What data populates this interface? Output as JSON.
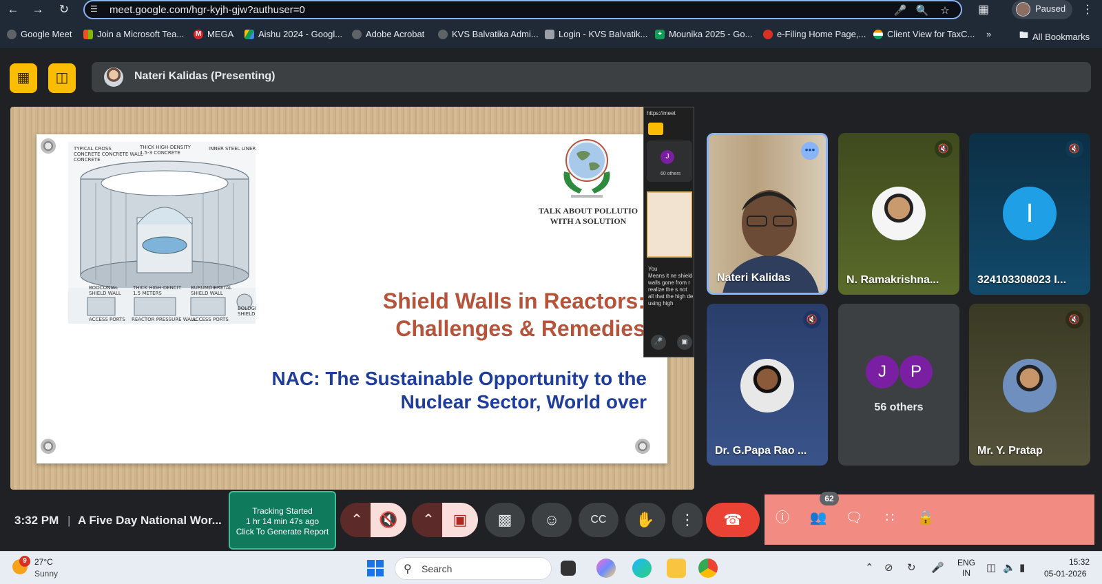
{
  "browser": {
    "url": "meet.google.com/hgr-kyjh-gjw?authuser=0",
    "profile_label": "Paused",
    "bookmarks": [
      {
        "label": "Google Meet",
        "color": "#e8eaed"
      },
      {
        "label": "Join a Microsoft Tea...",
        "color": "#f25022"
      },
      {
        "label": "MEGA",
        "color": "#d9272e"
      },
      {
        "label": "Aishu 2024 - Googl...",
        "color": "#0f9d58"
      },
      {
        "label": "Adobe Acrobat",
        "color": "#e8eaed"
      },
      {
        "label": "KVS Balvatika Admi...",
        "color": "#e8eaed"
      },
      {
        "label": "Login - KVS Balvatik...",
        "color": "#9aa0a6"
      },
      {
        "label": "Mounika 2025 - Go...",
        "color": "#0f9d58"
      },
      {
        "label": "e-Filing Home Page,...",
        "color": "#d93025"
      },
      {
        "label": "Client View for TaxC...",
        "color": "#f29900"
      }
    ],
    "more_bookmarks": "»",
    "all_bookmarks": "All Bookmarks"
  },
  "meet": {
    "presenter_label": "Nateri Kalidas (Presenting)",
    "slide": {
      "diagram_labels": {
        "typical": "TYPICAL CROSS\nCONCRETE CONCRETE WALL\nCONCRETE",
        "thick": "THICK HIGH-DENSITY\n1.5-3 CONCRETE",
        "inner": "INNER STEEL LINER",
        "bottom1": "BOOCONIAL\nSHIELD WALL",
        "bottom2": "THICK HIGH-DENCIT\n1.5 METERS",
        "bottom3": "BURUMDIKRETAL\nSHIELD WALL",
        "bottom4": "BOLDGI\nSHIELD",
        "foot1": "ACCESS PORTS",
        "foot2": "REACTOR PRESSURE WALL",
        "foot3": "ACCESS PORTS"
      },
      "emblem_caption_line1": "TALK ABOUT POLLUTIO",
      "emblem_caption_line2": "WITH A SOLUTION",
      "title_line1": "Shield Walls in Reactors:",
      "title_line2": "Challenges & Remedies",
      "subtitle_line1": "NAC: The Sustainable Opportunity to the",
      "subtitle_line2": "Nuclear Sector, World over"
    },
    "mini_window": {
      "url": "https://meet",
      "others": "60 others",
      "chat_sender": "You",
      "chat_text": "Means it ne shield walls gone from r realize the s not all that the high de using high"
    },
    "participants": [
      {
        "name": "Nateri Kalidas",
        "state": "speaking"
      },
      {
        "name": "N. Ramakrishna...",
        "state": "muted"
      },
      {
        "name": "324103308023 I...",
        "initial": "I",
        "state": "muted"
      },
      {
        "name": "Dr. G.Papa Rao ...",
        "state": "muted"
      },
      {
        "name": "56 others",
        "initials": [
          "J",
          "P"
        ]
      },
      {
        "name": "Mr. Y. Pratap",
        "state": "muted"
      }
    ],
    "time": "3:32 PM",
    "separator": "|",
    "meeting_title": "A Five Day National Wor...",
    "tracking": {
      "line1": "Tracking Started",
      "line2": "1 hr 14 min 47s ago",
      "line3": "Click To Generate Report"
    },
    "people_count": "62"
  },
  "taskbar": {
    "weather_temp": "27°C",
    "weather_desc": "Sunny",
    "weather_badge": "9",
    "search_placeholder": "Search",
    "lang_line1": "ENG",
    "lang_line2": "IN",
    "clock_time": "15:32",
    "clock_date": "05-01-2026"
  }
}
